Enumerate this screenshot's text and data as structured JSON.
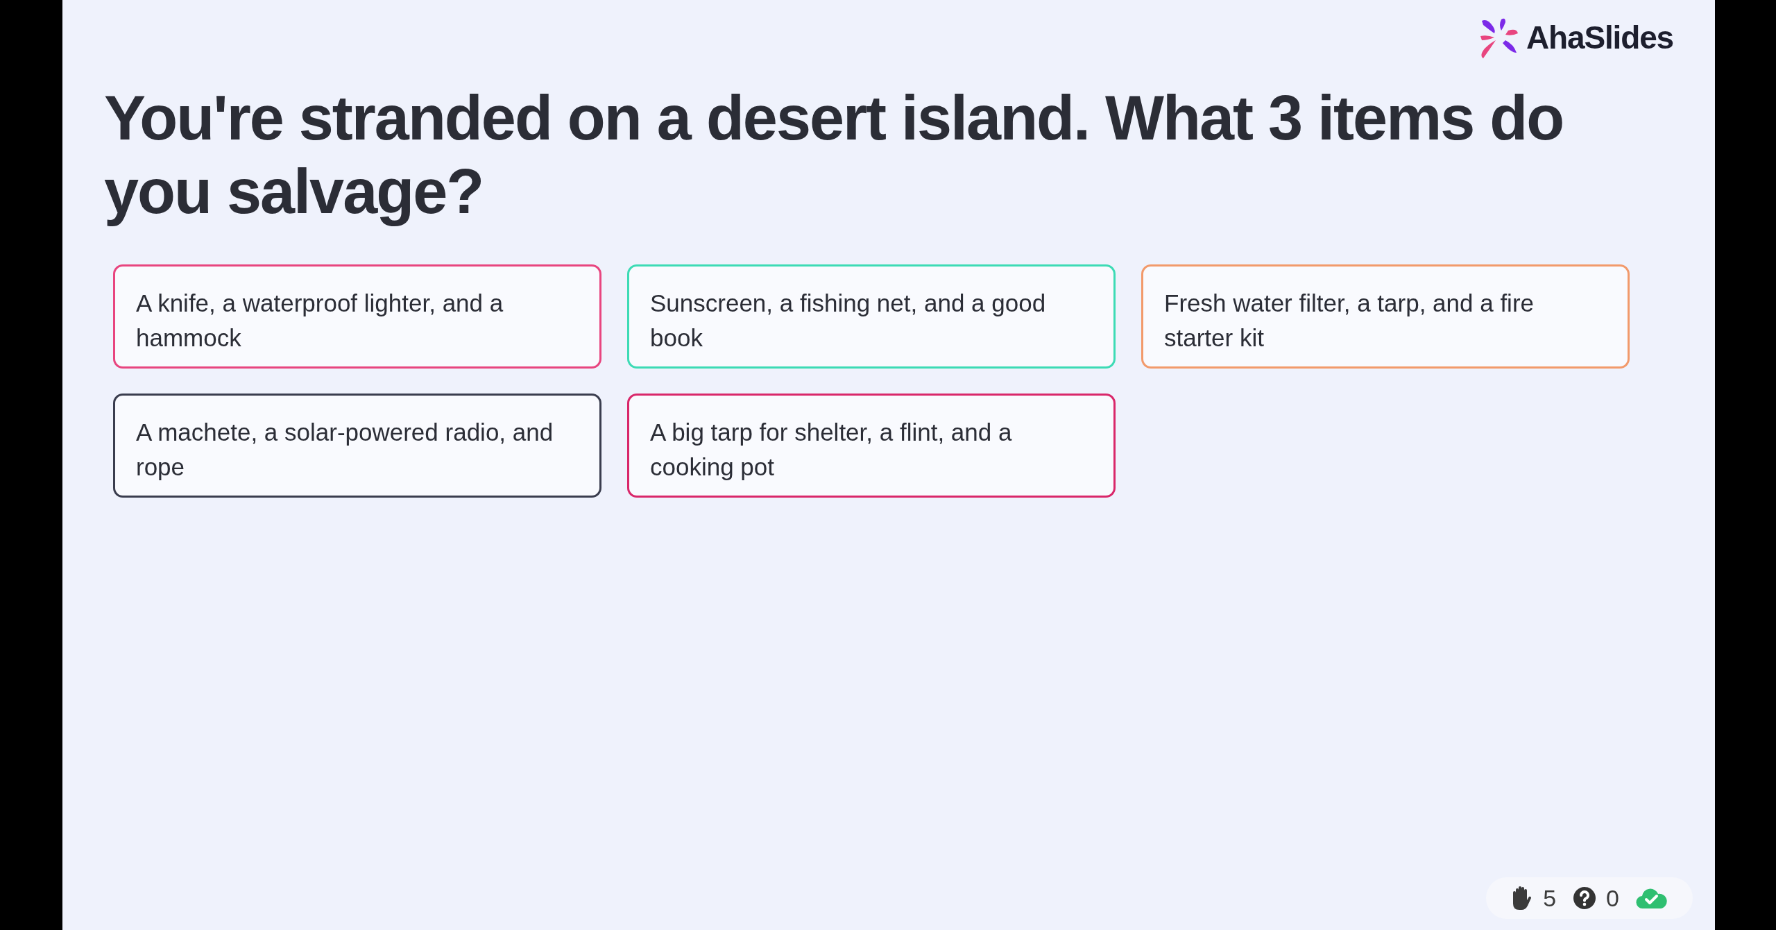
{
  "logo": {
    "text": "AhaSlides"
  },
  "question": "You're stranded on a desert island. What 3 items do you salvage?",
  "options": [
    {
      "text": "A knife, a waterproof lighter, and a hammock",
      "color": "#e8457f"
    },
    {
      "text": "Sunscreen, a fishing net, and a good book",
      "color": "#3ddbb5"
    },
    {
      "text": "Fresh water filter, a tarp, and a fire starter kit",
      "color": "#f29a6b"
    },
    {
      "text": "A machete, a solar-powered radio, and rope",
      "color": "#3a3d4e"
    },
    {
      "text": "A big tarp for shelter, a flint, and a cooking pot",
      "color": "#d9276a"
    }
  ],
  "status": {
    "hands": "5",
    "questions": "0"
  }
}
